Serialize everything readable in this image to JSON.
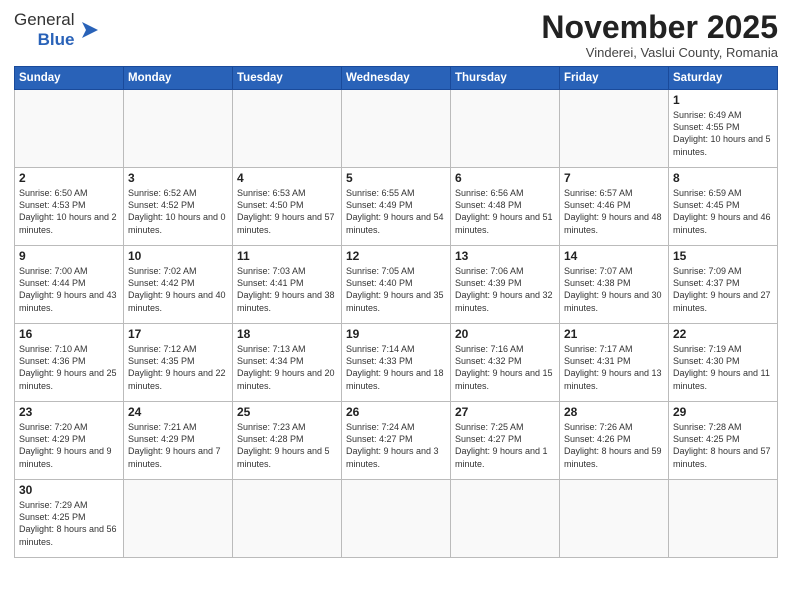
{
  "header": {
    "logo_general": "General",
    "logo_blue": "Blue",
    "month_title": "November 2025",
    "subtitle": "Vinderei, Vaslui County, Romania"
  },
  "days_of_week": [
    "Sunday",
    "Monday",
    "Tuesday",
    "Wednesday",
    "Thursday",
    "Friday",
    "Saturday"
  ],
  "weeks": [
    [
      {
        "day": "",
        "info": ""
      },
      {
        "day": "",
        "info": ""
      },
      {
        "day": "",
        "info": ""
      },
      {
        "day": "",
        "info": ""
      },
      {
        "day": "",
        "info": ""
      },
      {
        "day": "",
        "info": ""
      },
      {
        "day": "1",
        "info": "Sunrise: 6:49 AM\nSunset: 4:55 PM\nDaylight: 10 hours and 5 minutes."
      }
    ],
    [
      {
        "day": "2",
        "info": "Sunrise: 6:50 AM\nSunset: 4:53 PM\nDaylight: 10 hours and 2 minutes."
      },
      {
        "day": "3",
        "info": "Sunrise: 6:52 AM\nSunset: 4:52 PM\nDaylight: 10 hours and 0 minutes."
      },
      {
        "day": "4",
        "info": "Sunrise: 6:53 AM\nSunset: 4:50 PM\nDaylight: 9 hours and 57 minutes."
      },
      {
        "day": "5",
        "info": "Sunrise: 6:55 AM\nSunset: 4:49 PM\nDaylight: 9 hours and 54 minutes."
      },
      {
        "day": "6",
        "info": "Sunrise: 6:56 AM\nSunset: 4:48 PM\nDaylight: 9 hours and 51 minutes."
      },
      {
        "day": "7",
        "info": "Sunrise: 6:57 AM\nSunset: 4:46 PM\nDaylight: 9 hours and 48 minutes."
      },
      {
        "day": "8",
        "info": "Sunrise: 6:59 AM\nSunset: 4:45 PM\nDaylight: 9 hours and 46 minutes."
      }
    ],
    [
      {
        "day": "9",
        "info": "Sunrise: 7:00 AM\nSunset: 4:44 PM\nDaylight: 9 hours and 43 minutes."
      },
      {
        "day": "10",
        "info": "Sunrise: 7:02 AM\nSunset: 4:42 PM\nDaylight: 9 hours and 40 minutes."
      },
      {
        "day": "11",
        "info": "Sunrise: 7:03 AM\nSunset: 4:41 PM\nDaylight: 9 hours and 38 minutes."
      },
      {
        "day": "12",
        "info": "Sunrise: 7:05 AM\nSunset: 4:40 PM\nDaylight: 9 hours and 35 minutes."
      },
      {
        "day": "13",
        "info": "Sunrise: 7:06 AM\nSunset: 4:39 PM\nDaylight: 9 hours and 32 minutes."
      },
      {
        "day": "14",
        "info": "Sunrise: 7:07 AM\nSunset: 4:38 PM\nDaylight: 9 hours and 30 minutes."
      },
      {
        "day": "15",
        "info": "Sunrise: 7:09 AM\nSunset: 4:37 PM\nDaylight: 9 hours and 27 minutes."
      }
    ],
    [
      {
        "day": "16",
        "info": "Sunrise: 7:10 AM\nSunset: 4:36 PM\nDaylight: 9 hours and 25 minutes."
      },
      {
        "day": "17",
        "info": "Sunrise: 7:12 AM\nSunset: 4:35 PM\nDaylight: 9 hours and 22 minutes."
      },
      {
        "day": "18",
        "info": "Sunrise: 7:13 AM\nSunset: 4:34 PM\nDaylight: 9 hours and 20 minutes."
      },
      {
        "day": "19",
        "info": "Sunrise: 7:14 AM\nSunset: 4:33 PM\nDaylight: 9 hours and 18 minutes."
      },
      {
        "day": "20",
        "info": "Sunrise: 7:16 AM\nSunset: 4:32 PM\nDaylight: 9 hours and 15 minutes."
      },
      {
        "day": "21",
        "info": "Sunrise: 7:17 AM\nSunset: 4:31 PM\nDaylight: 9 hours and 13 minutes."
      },
      {
        "day": "22",
        "info": "Sunrise: 7:19 AM\nSunset: 4:30 PM\nDaylight: 9 hours and 11 minutes."
      }
    ],
    [
      {
        "day": "23",
        "info": "Sunrise: 7:20 AM\nSunset: 4:29 PM\nDaylight: 9 hours and 9 minutes."
      },
      {
        "day": "24",
        "info": "Sunrise: 7:21 AM\nSunset: 4:29 PM\nDaylight: 9 hours and 7 minutes."
      },
      {
        "day": "25",
        "info": "Sunrise: 7:23 AM\nSunset: 4:28 PM\nDaylight: 9 hours and 5 minutes."
      },
      {
        "day": "26",
        "info": "Sunrise: 7:24 AM\nSunset: 4:27 PM\nDaylight: 9 hours and 3 minutes."
      },
      {
        "day": "27",
        "info": "Sunrise: 7:25 AM\nSunset: 4:27 PM\nDaylight: 9 hours and 1 minute."
      },
      {
        "day": "28",
        "info": "Sunrise: 7:26 AM\nSunset: 4:26 PM\nDaylight: 8 hours and 59 minutes."
      },
      {
        "day": "29",
        "info": "Sunrise: 7:28 AM\nSunset: 4:25 PM\nDaylight: 8 hours and 57 minutes."
      }
    ],
    [
      {
        "day": "30",
        "info": "Sunrise: 7:29 AM\nSunset: 4:25 PM\nDaylight: 8 hours and 56 minutes."
      },
      {
        "day": "",
        "info": ""
      },
      {
        "day": "",
        "info": ""
      },
      {
        "day": "",
        "info": ""
      },
      {
        "day": "",
        "info": ""
      },
      {
        "day": "",
        "info": ""
      },
      {
        "day": "",
        "info": ""
      }
    ]
  ]
}
